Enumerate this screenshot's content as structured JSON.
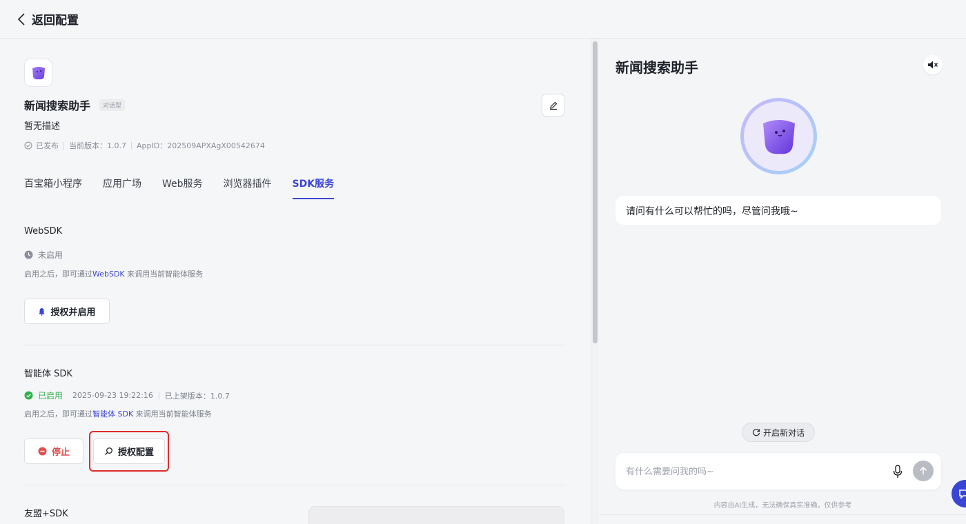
{
  "topbar": {
    "back_label": "返回配置"
  },
  "app": {
    "name": "新闻搜索助手",
    "type_badge": "对话型",
    "description": "暂无描述",
    "status": "已发布",
    "version": "当前版本：1.0.7",
    "app_id": "AppID：202509APXAgX00542674"
  },
  "tabs": [
    {
      "label": "百宝箱小程序",
      "active": false
    },
    {
      "label": "应用广场",
      "active": false
    },
    {
      "label": "Web服务",
      "active": false
    },
    {
      "label": "浏览器插件",
      "active": false
    },
    {
      "label": "SDK服务",
      "active": true
    }
  ],
  "websdk": {
    "title": "WebSDK",
    "status": "未启用",
    "hint_prefix": "启用之后，即可通过",
    "hint_link": "WebSDK",
    "hint_suffix": " 来调用当前智能体服务",
    "button_label": "授权并启用"
  },
  "agent_sdk": {
    "title": "智能体 SDK",
    "status": "已启用",
    "datetime": "2025-09-23 19:22:16",
    "version": "已上架版本：1.0.7",
    "hint_prefix": "启用之后，即可通过",
    "hint_link": "智能体 SDK",
    "hint_suffix": " 来调用当前智能体服务",
    "stop_label": "停止",
    "config_label": "授权配置"
  },
  "umeng_sdk": {
    "title": "友盟+SDK"
  },
  "chat": {
    "title": "新闻搜索助手",
    "welcome": "请问有什么可以帮忙的吗，尽管问我哦~",
    "new_chat_label": "开启新对话",
    "input_placeholder": "有什么需要问我的吗~",
    "disclaimer": "内容由AI生成，无法确保真实准确，仅供参考"
  },
  "colors": {
    "accent": "#3b45d4",
    "success": "#2fb24c",
    "danger": "#e34d4d",
    "highlight": "#e02b2b"
  },
  "icons": [
    "chevron-left-icon",
    "edit-icon",
    "check-circle-icon",
    "clock-icon",
    "bell-icon",
    "stop-icon",
    "search-icon",
    "mute-icon",
    "refresh-icon",
    "mic-icon",
    "arrow-up-icon",
    "bot-icon"
  ]
}
